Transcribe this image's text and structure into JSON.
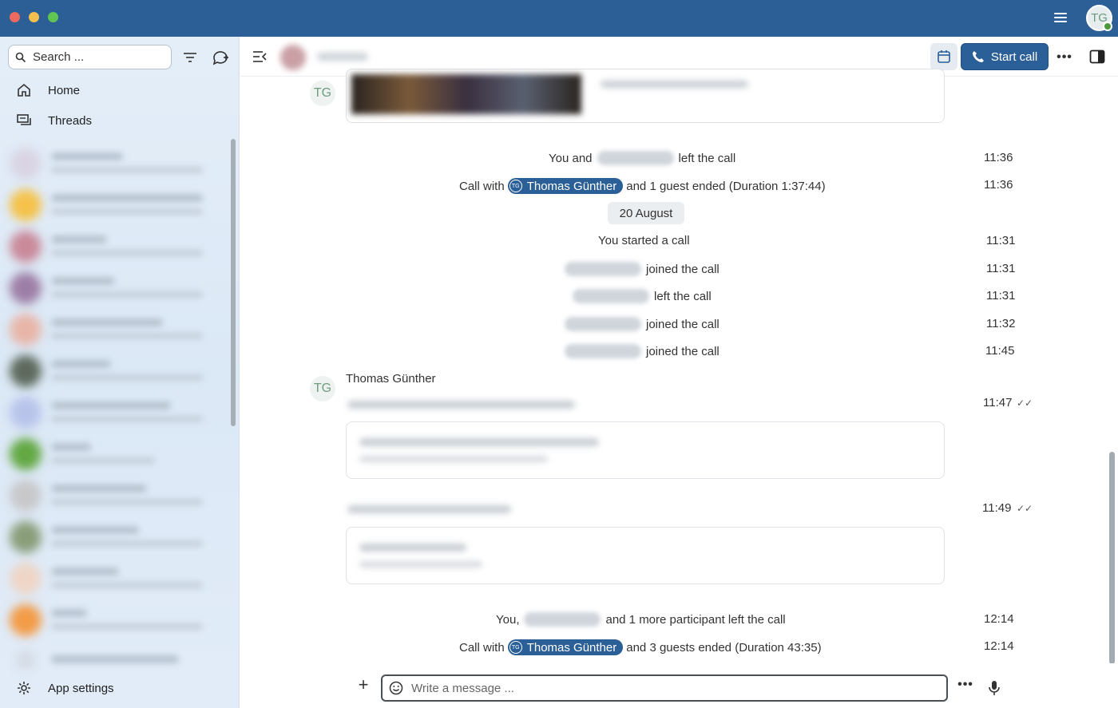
{
  "titlebar": {
    "avatar_initials": "TG"
  },
  "sidebar": {
    "search_label": "Search ...",
    "nav": {
      "home": "Home",
      "threads": "Threads"
    },
    "app_settings": "App settings"
  },
  "header": {
    "start_call": "Start call"
  },
  "messages": {
    "row1": {
      "prefix": "You and",
      "suffix": "left the call",
      "time": "11:36"
    },
    "row2": {
      "prefix": "Call with",
      "mention": "Thomas Günther",
      "mention_initials": "TG",
      "suffix": "and 1 guest ended (Duration 1:37:44)",
      "time": "11:36"
    },
    "date_divider": "20 August",
    "row3": {
      "text": "You started a call",
      "time": "11:31"
    },
    "row4": {
      "suffix": "joined the call",
      "time": "11:31"
    },
    "row5": {
      "suffix": "left the call",
      "time": "11:31"
    },
    "row6": {
      "suffix": "joined the call",
      "time": "11:32"
    },
    "row7": {
      "suffix": "joined the call",
      "time": "11:45"
    },
    "sender": {
      "initials": "TG",
      "name": "Thomas Günther"
    },
    "msg1_time": "11:47",
    "msg2_time": "11:49",
    "row8": {
      "prefix": "You,",
      "suffix": "and 1 more participant left the call",
      "time": "12:14"
    },
    "row9": {
      "prefix": "Call with",
      "mention": "Thomas Günther",
      "mention_initials": "TG",
      "suffix": "and 3 guests ended (Duration 43:35)",
      "time": "12:14"
    }
  },
  "composer": {
    "placeholder": "Write a message ..."
  },
  "colors": {
    "titlebar": "#2c5f96",
    "accent": "#2a5f97",
    "presence": "#4a9a3b"
  },
  "icons": [
    "search-icon",
    "filter-icon",
    "new-chat-icon",
    "home-icon",
    "threads-icon",
    "collapse-sidebar-icon",
    "calendar-icon",
    "phone-icon",
    "more-icon",
    "side-panel-icon",
    "emoji-icon",
    "plus-icon",
    "mic-icon",
    "gear-icon",
    "double-check-icon"
  ]
}
